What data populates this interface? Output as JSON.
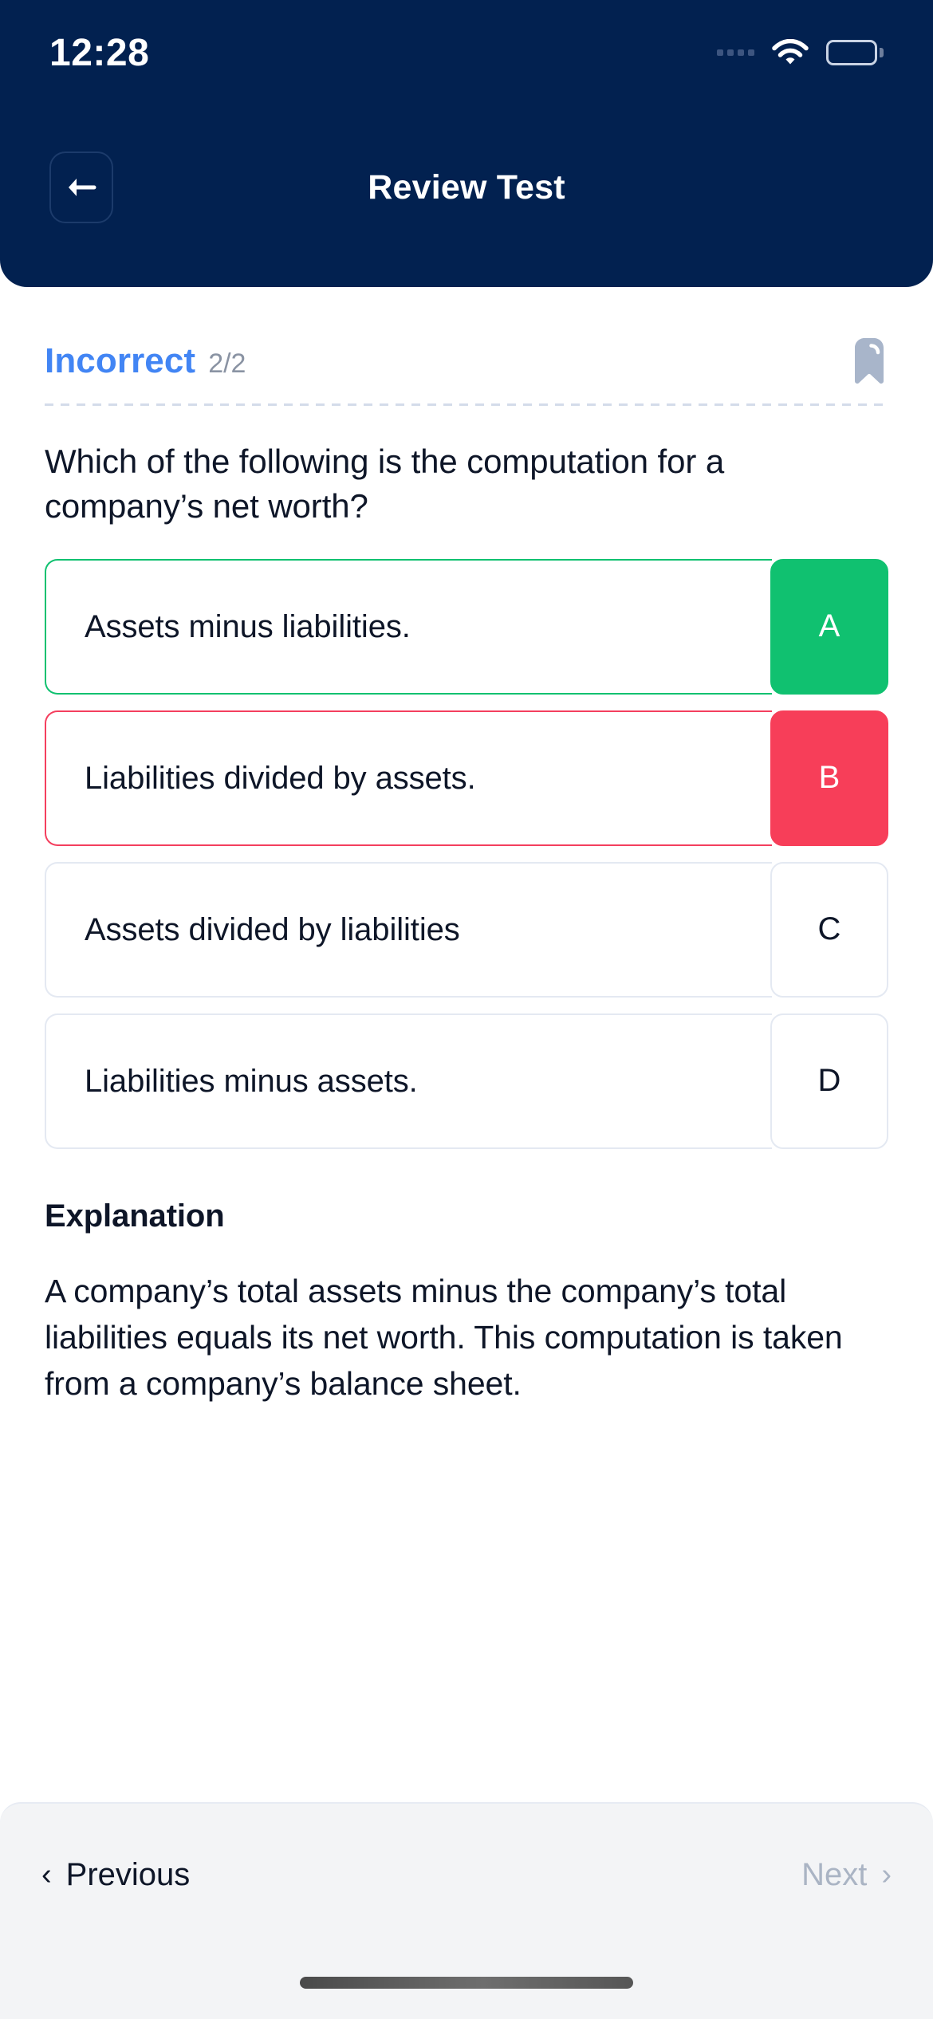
{
  "status_bar": {
    "time": "12:28",
    "signal_icon": "signal-dots-icon",
    "wifi_icon": "wifi-icon",
    "battery_icon": "battery-icon"
  },
  "header": {
    "title": "Review Test",
    "back_icon": "back-arrow-icon"
  },
  "review": {
    "result_label": "Incorrect",
    "result_count": "2/2",
    "result_color": "#4285f4",
    "count_color": "#8a93a3",
    "bookmark_icon": "bookmark-icon",
    "question": "Which of the following is the computation for a company’s net worth?",
    "options": [
      {
        "letter": "A",
        "text": "Assets minus liabilities.",
        "state": "correct"
      },
      {
        "letter": "B",
        "text": "Liabilities divided by assets.",
        "state": "incorrect"
      },
      {
        "letter": "C",
        "text": "Assets divided by liabilities",
        "state": "neutral"
      },
      {
        "letter": "D",
        "text": "Liabilities minus assets.",
        "state": "neutral"
      }
    ],
    "explanation_title": "Explanation",
    "explanation_body": "A company’s total assets minus the company’s total liabilities equals its net worth. This computation is taken from a company’s balance sheet."
  },
  "footer": {
    "previous_label": "Previous",
    "previous_chevron": "‹",
    "next_label": "Next",
    "next_chevron": "›"
  },
  "colors": {
    "header_bg": "#022150",
    "correct": "#10c170",
    "incorrect": "#f73e59",
    "neutral_border": "#e4e9f2",
    "footer_bg": "#f3f4f6"
  }
}
